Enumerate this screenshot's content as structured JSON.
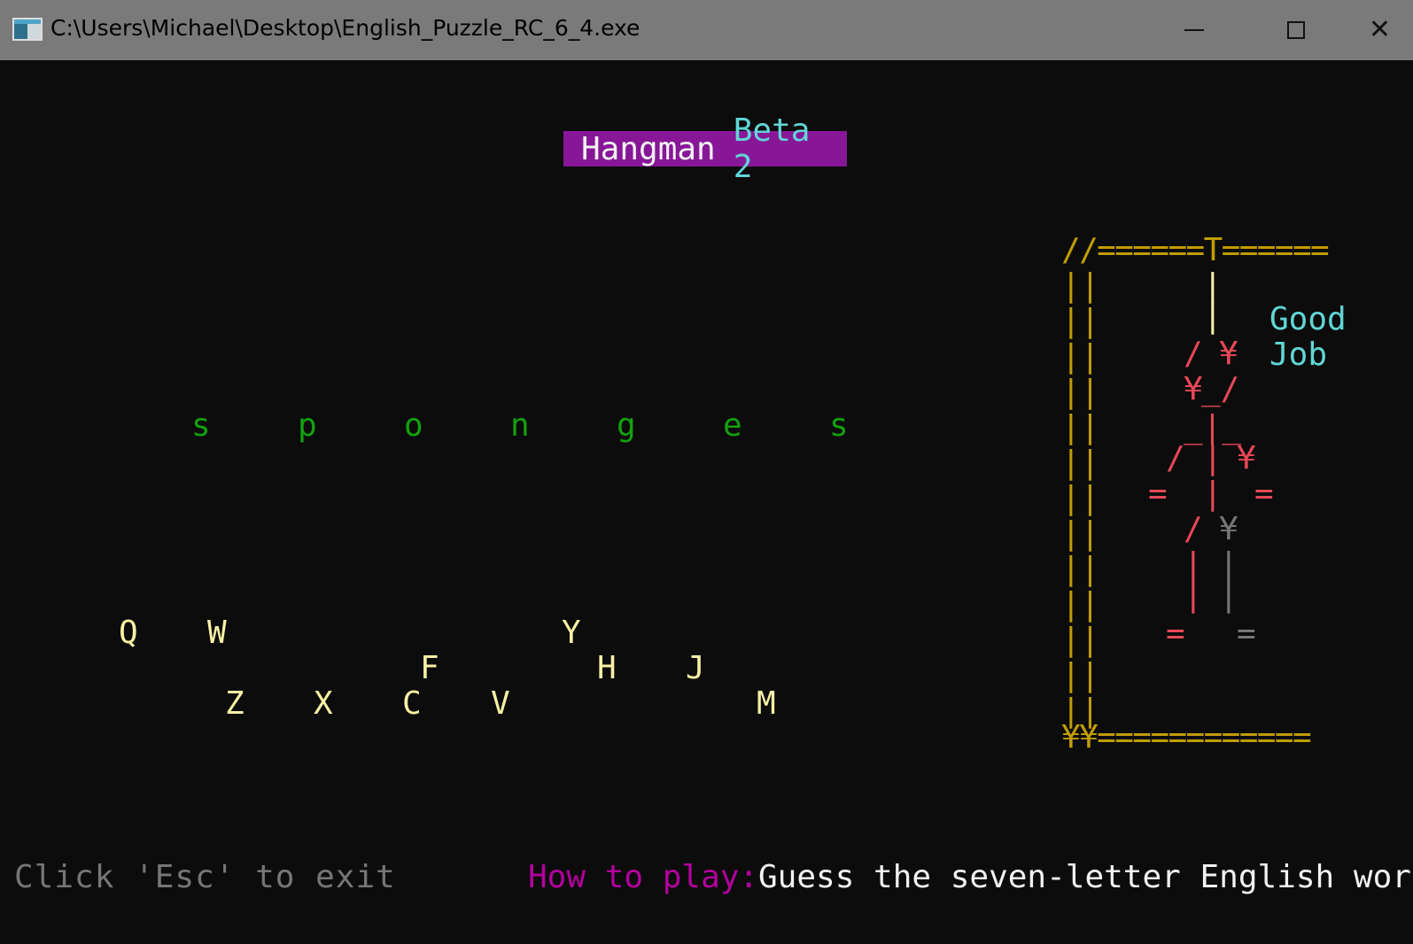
{
  "window": {
    "title": "C:\\Users\\Michael\\Desktop\\English_Puzzle_RC_6_4.exe",
    "minimize_glyph": "minimize-icon",
    "maximize_glyph": "maximize-icon",
    "close_label": "✕"
  },
  "banner": {
    "word1": "Hangman",
    "word2": "Beta 2"
  },
  "word_letters": [
    "s",
    "p",
    "o",
    "n",
    "g",
    "e",
    "s"
  ],
  "remaining_keys": [
    "Q",
    "W",
    "Y",
    "F",
    "H",
    "J",
    "Z",
    "X",
    "C",
    "V",
    "M"
  ],
  "gallows": {
    "top": "//======T======",
    "base": "¥¥============",
    "post": "||"
  },
  "figure": {
    "rope": "|",
    "head_left": "/",
    "head_right_eye": "¥",
    "head_left_eye": "¥",
    "head_jaw": "_/",
    "shoulders": "_|_",
    "arm_left": "/",
    "arm_right": "¥",
    "hand": "=",
    "leg_left_top": "/",
    "leg_right_top": "¥",
    "leg": "|",
    "foot": "="
  },
  "result": {
    "line1": "Good",
    "line2": "Job"
  },
  "footer": {
    "exit_hint": "Click 'Esc' to exit",
    "howto_label": "How to play:",
    "howto_text": "Guess the seven-letter English word"
  },
  "colors": {
    "background": "#0c0c0c",
    "titlebar": "#7a7a7a",
    "banner_bg": "#881798",
    "word": "#13a10e",
    "keys": "#f9f1a5",
    "gallows": "#c19c00",
    "figure_red": "#e74856",
    "figure_gray": "#767676",
    "result": "#61d6d6",
    "howto_label": "#b4009e"
  }
}
